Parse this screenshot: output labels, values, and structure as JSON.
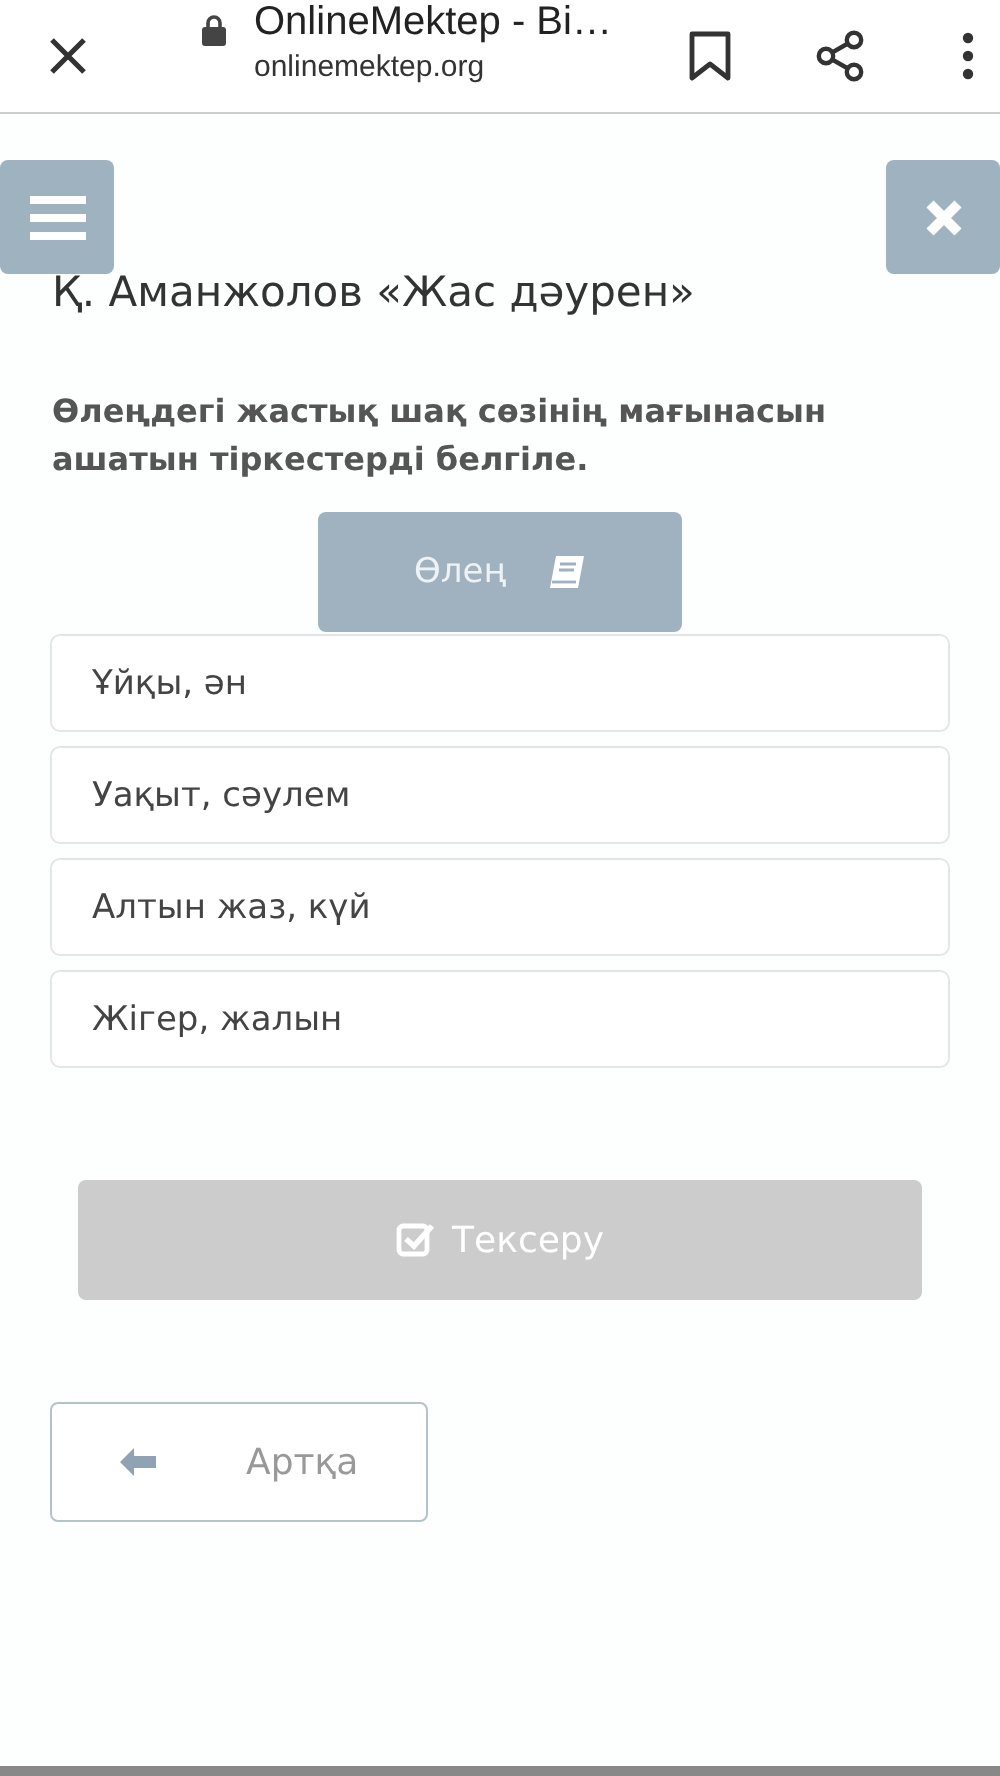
{
  "browser": {
    "title": "OnlineMektep - Bi…",
    "url": "onlinemektep.org"
  },
  "heading": "Қ. Аманжолов «Жас дәурен»",
  "question": "Өлеңдегі жастық шақ сөзінің мағынасын ашатын тіркестерді белгіле.",
  "poem_button": "Өлең",
  "options": [
    {
      "text": "Ұйқы, ән",
      "selected": false
    },
    {
      "text": "Уақыт, сәулем",
      "selected": false
    },
    {
      "text": "Алтын жаз, күй",
      "selected": false
    },
    {
      "text": "Жігер, жалын",
      "selected": false
    }
  ],
  "check_button": {
    "label": "Тексеру",
    "disabled": true
  },
  "back_button": "Артқа"
}
